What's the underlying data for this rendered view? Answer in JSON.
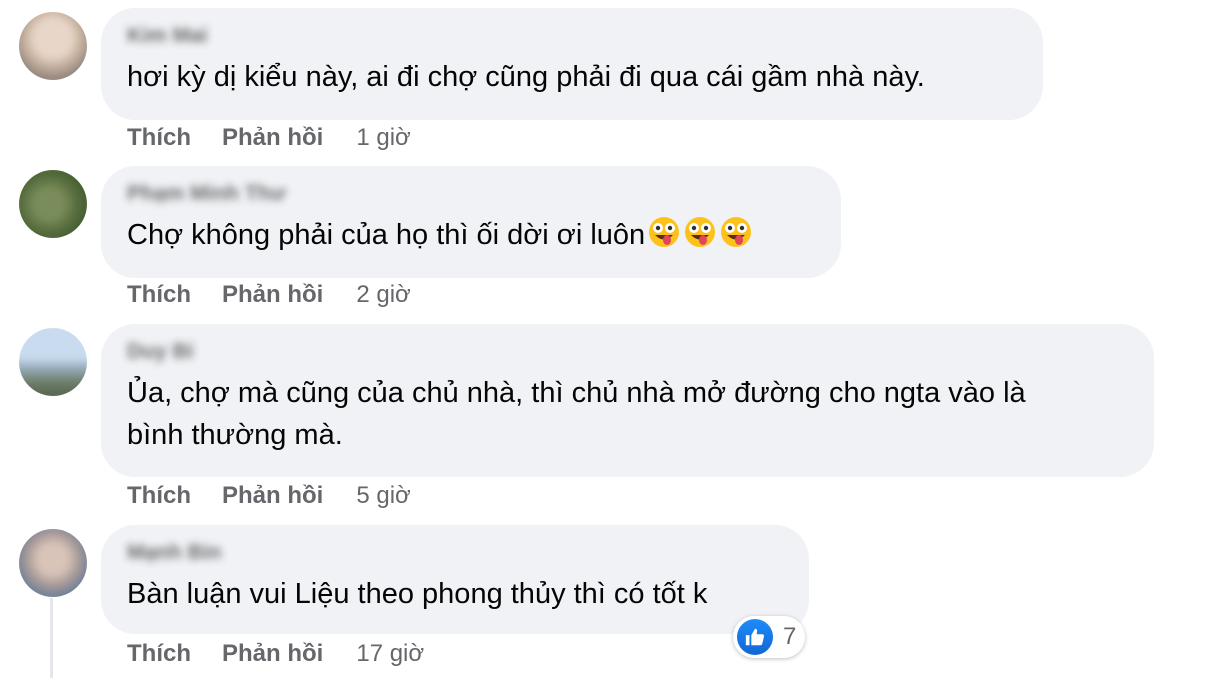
{
  "comments": [
    {
      "author": "Kim Mai",
      "text": "hơi kỳ dị kiểu này, ai đi chợ cũng phải đi qua cái gầm nhà này.",
      "like_label": "Thích",
      "reply_label": "Phản hồi",
      "time": "1 giờ"
    },
    {
      "author": "Phạm Minh Thư",
      "text": "Chợ không phải của họ thì ối dời ơi luôn",
      "like_label": "Thích",
      "reply_label": "Phản hồi",
      "time": "2 giờ"
    },
    {
      "author": "Duy Bí",
      "text_line1": "Ủa, chợ mà cũng của chủ nhà, thì chủ nhà mở đường cho ngta vào là",
      "text_line2": "bình thường mà.",
      "like_label": "Thích",
      "reply_label": "Phản hồi",
      "time": "5 giờ"
    },
    {
      "author": "Mạnh Bin",
      "text": "Bàn luận vui Liệu theo phong thủy thì có tốt k",
      "like_label": "Thích",
      "reply_label": "Phản hồi",
      "time": "17 giờ",
      "reaction_count": "7"
    }
  ],
  "icons": {
    "reaction": "like-icon",
    "emoji": "zany-face-emoji"
  },
  "colors": {
    "bubble": "#f0f2f5",
    "muted_text": "#65676b",
    "like_blue": "#1877f2"
  }
}
